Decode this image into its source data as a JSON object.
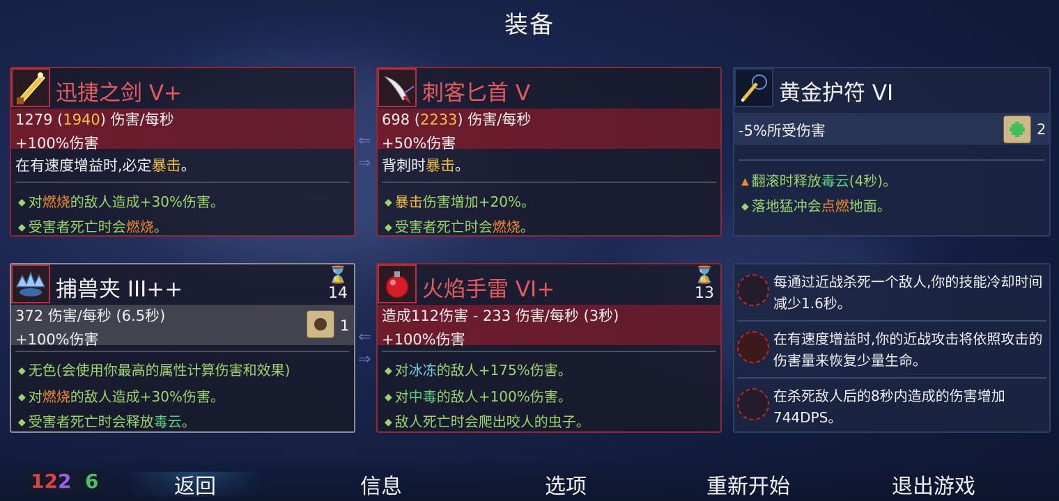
{
  "title": "装备",
  "cards": [
    {
      "name": "迅捷之剑 V+",
      "dps": "1279",
      "dps_crit": "1940",
      "dps_unit": " 伤害/每秒",
      "stat": "+100%伤害",
      "desc_a": "在有速度增益时,必定",
      "desc_b": "暴击",
      "desc_c": "。",
      "bullets": [
        {
          "a": "对",
          "b": "燃烧",
          "c": "的敌人造成+30%伤害。"
        },
        {
          "a": "受害者死亡时会",
          "b": "燃烧",
          "c": "。"
        }
      ]
    },
    {
      "name": "刺客匕首 V",
      "dps": "698",
      "dps_crit": "2233",
      "dps_unit": " 伤害/每秒",
      "stat": "+50%伤害",
      "desc_a": "背刺时",
      "desc_b": "暴击",
      "desc_c": "。",
      "bullets": [
        {
          "a": "",
          "b": "暴击",
          "c": "伤害增加+20%。"
        },
        {
          "a": "受害者死亡时会",
          "b": "燃烧",
          "c": "。"
        }
      ]
    },
    {
      "name": "黄金护符 VI",
      "stat": "-5%所受伤害",
      "scroll_count": "2",
      "bullets": [
        {
          "a": "翻滚时释放",
          "b": "毒云",
          "c": "(4秒)。"
        },
        {
          "a": "落地猛冲会",
          "b": "点燃",
          "c": "地面。"
        }
      ]
    },
    {
      "name": "捕兽夹 III++",
      "cooldown": "14",
      "stat1": "372 伤害/每秒 (6.5秒)",
      "stat2": "+100%伤害",
      "scroll_count": "1",
      "bullets": [
        {
          "a": "无色(会使用你最高的属性计算伤害和效果)",
          "b": "",
          "c": ""
        },
        {
          "a": "对",
          "b": "燃烧",
          "c": "的敌人造成+30%伤害。"
        },
        {
          "a": "受害者死亡时会释放",
          "b": "毒云",
          "c": "。"
        }
      ]
    },
    {
      "name": "火焰手雷 VI+",
      "cooldown": "13",
      "stat1": "造成112伤害 - 233 伤害/每秒 (3秒)",
      "stat2": "+100%伤害",
      "bullets": [
        {
          "a": "对",
          "b": "冰冻",
          "c": "的敌人+175%伤害。"
        },
        {
          "a": "对",
          "b": "中毒",
          "c": "的敌人+100%伤害。"
        },
        {
          "a": "敌人死亡时会爬出咬人的虫子。",
          "b": "",
          "c": ""
        }
      ]
    }
  ],
  "bonuses": [
    "每通过近战杀死一个敌人,你的技能冷却时间减少1.6秒。",
    "在有速度增益时,你的近战攻击将依照攻击的伤害量来恢复少量生命。",
    "在杀死敌人后的8秒内造成的伤害增加744DPS。"
  ],
  "stats": {
    "brutality": "12",
    "tactics": "2",
    "survival": "6"
  },
  "menu": [
    "返回",
    "信息",
    "选项",
    "重新开始",
    "退出游戏"
  ],
  "colors": {
    "brutality": "#e04040",
    "tactics": "#a060e0",
    "survival": "#4ac060",
    "legendary_border": "#8f2a34"
  }
}
